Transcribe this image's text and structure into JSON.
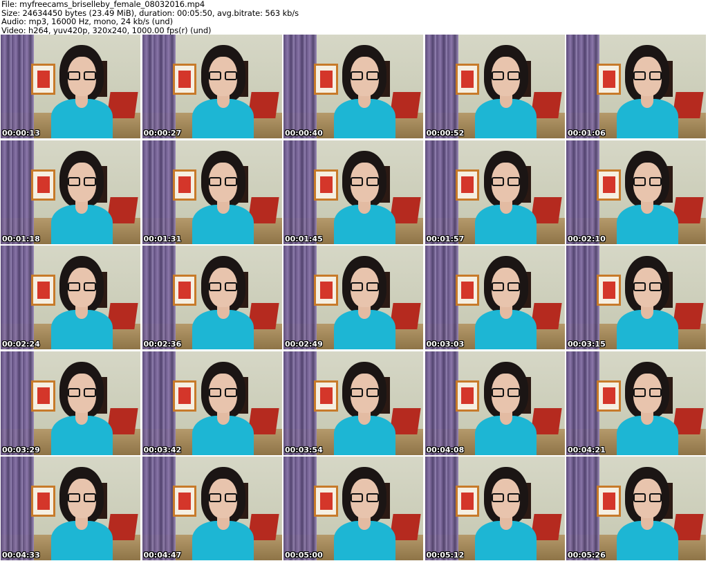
{
  "header": {
    "file": "File: myfreecams_briselleby_female_08032016.mp4",
    "size": "Size: 24634450 bytes (23.49 MiB), duration: 00:05:50, avg.bitrate: 563 kb/s",
    "audio": "Audio: mp3, 16000 Hz, mono, 24 kb/s (und)",
    "video": "Video: h264, yuv420p, 320x240, 1000.00 fps(r) (und)"
  },
  "thumbnails": [
    {
      "timestamp": "00:00:13"
    },
    {
      "timestamp": "00:00:27"
    },
    {
      "timestamp": "00:00:40"
    },
    {
      "timestamp": "00:00:52"
    },
    {
      "timestamp": "00:01:06"
    },
    {
      "timestamp": "00:01:18"
    },
    {
      "timestamp": "00:01:31"
    },
    {
      "timestamp": "00:01:45"
    },
    {
      "timestamp": "00:01:57"
    },
    {
      "timestamp": "00:02:10"
    },
    {
      "timestamp": "00:02:24"
    },
    {
      "timestamp": "00:02:36"
    },
    {
      "timestamp": "00:02:49"
    },
    {
      "timestamp": "00:03:03"
    },
    {
      "timestamp": "00:03:15"
    },
    {
      "timestamp": "00:03:29"
    },
    {
      "timestamp": "00:03:42"
    },
    {
      "timestamp": "00:03:54"
    },
    {
      "timestamp": "00:04:08"
    },
    {
      "timestamp": "00:04:21"
    },
    {
      "timestamp": "00:04:33"
    },
    {
      "timestamp": "00:04:47"
    },
    {
      "timestamp": "00:05:00"
    },
    {
      "timestamp": "00:05:12"
    },
    {
      "timestamp": "00:05:26"
    }
  ]
}
